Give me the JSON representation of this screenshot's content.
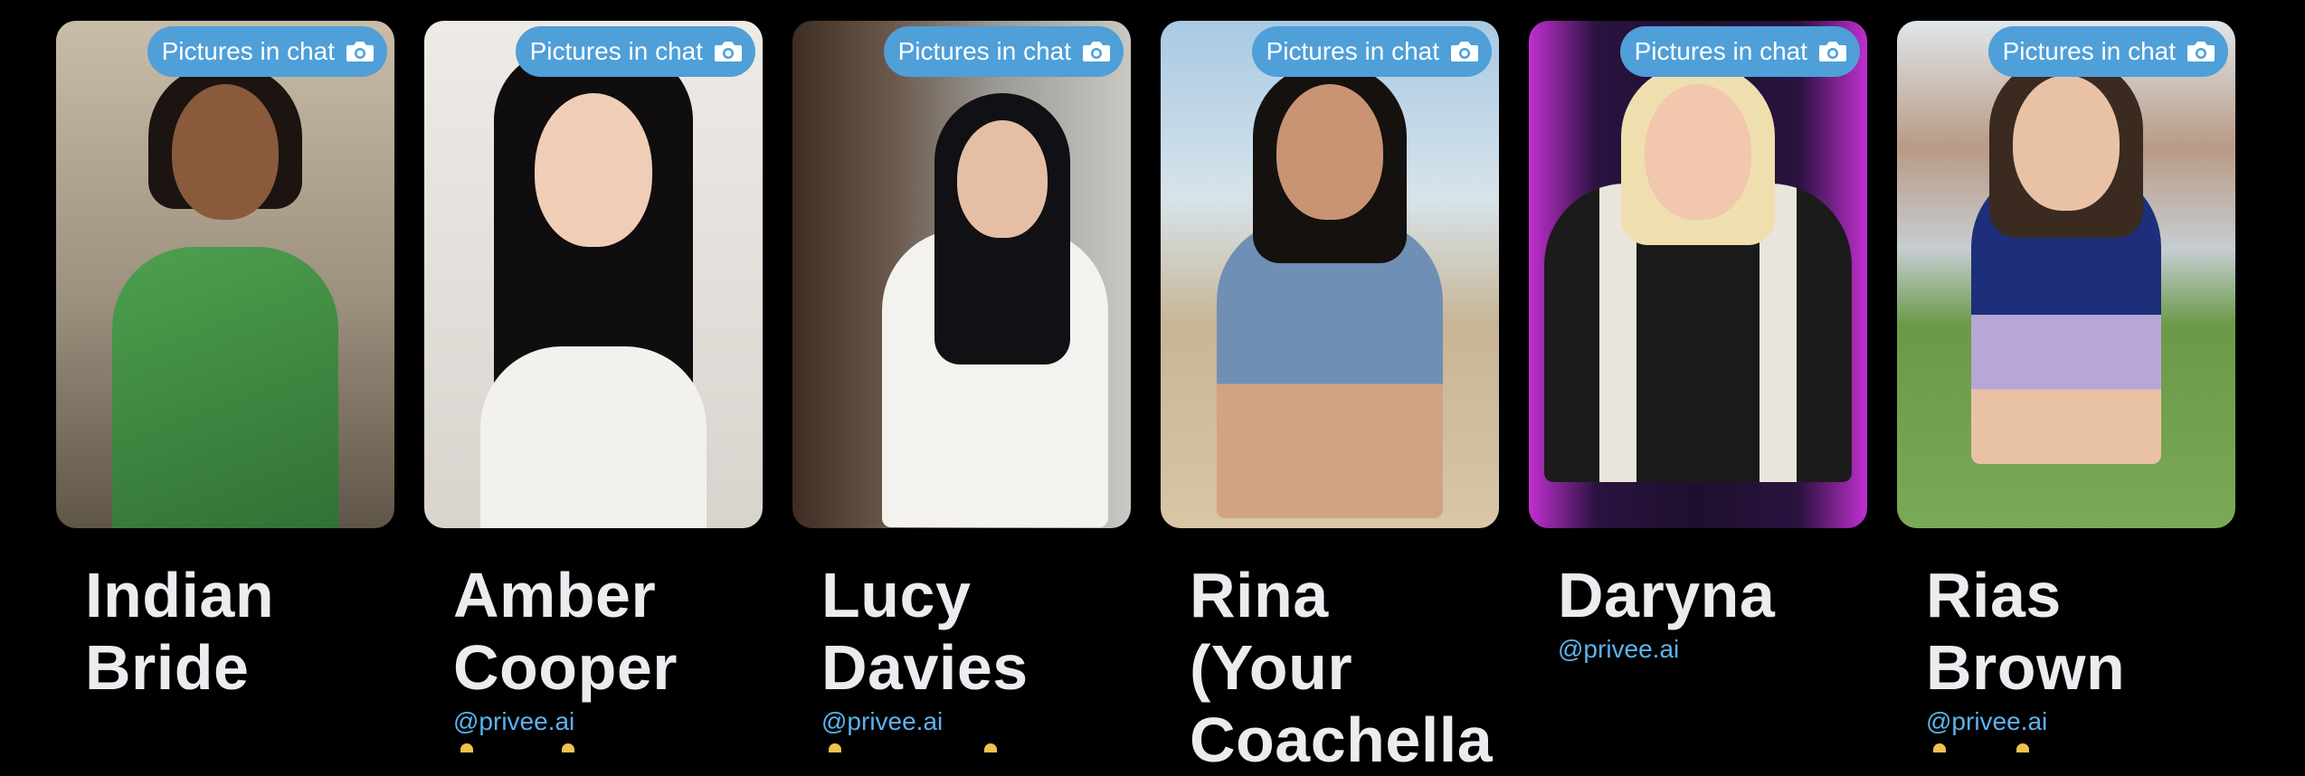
{
  "cards": [
    {
      "badge": "Pictures in chat",
      "name": "Indian Bride",
      "handle": "",
      "palette": {
        "bg": "#b6aa96",
        "bg2": "#6f6658",
        "skin": "#8a5a3c",
        "hair": "#1b1410",
        "outfit": "#3c8a3e"
      }
    },
    {
      "badge": "Pictures in chat",
      "name": "Amber Cooper",
      "handle": "@privee.ai",
      "palette": {
        "bg": "#e9e6e2",
        "bg2": "#cfcac4",
        "skin": "#f0cdb6",
        "hair": "#0f0d0e",
        "outfit": "#ece9e4"
      }
    },
    {
      "badge": "Pictures in chat",
      "name": "Lucy Davies",
      "handle": "@privee.ai",
      "palette": {
        "bg": "#8f8f8c",
        "bg2": "#4e3a2c",
        "skin": "#e4bfa6",
        "hair": "#111014",
        "outfit": "#f4f2ee"
      }
    },
    {
      "badge": "Pictures in chat",
      "name": "Rina (Your Coachella",
      "handle": "",
      "palette": {
        "bg": "#bcd3e6",
        "bg2": "#cdb89a",
        "skin": "#c99474",
        "hair": "#15110f",
        "outfit": "#6f8fb5"
      }
    },
    {
      "badge": "Pictures in chat",
      "name": "Daryna",
      "handle": "@privee.ai",
      "palette": {
        "bg": "#2a1340",
        "bg2": "#c12fd0",
        "skin": "#f1c7ad",
        "hair": "#f0dfae",
        "outfit": "#1a1a1a"
      }
    },
    {
      "badge": "Pictures in chat",
      "name": "Rias Brown",
      "handle": "@privee.ai",
      "palette": {
        "bg": "#c9d6df",
        "bg2": "#6a9a48",
        "skin": "#e9c2a6",
        "hair": "#3a2a20",
        "outfit": "#1d2f7a"
      }
    }
  ],
  "icons": {
    "badge": "camera-icon"
  },
  "colors": {
    "badge_bg": "#4f9fd9",
    "handle": "#5ab3ec",
    "page_bg": "#000000"
  }
}
